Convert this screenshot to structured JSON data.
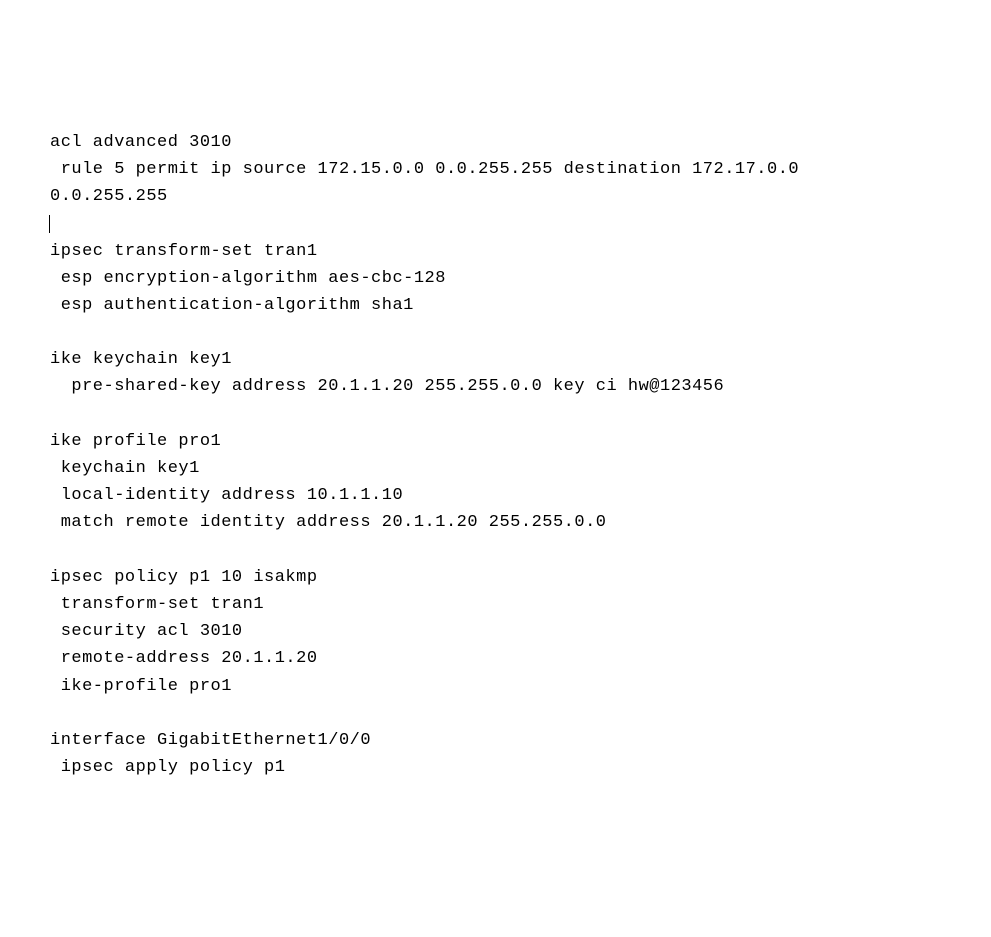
{
  "config": {
    "lines": [
      "acl advanced 3010",
      " rule 5 permit ip source 172.15.0.0 0.0.255.255 destination 172.17.0.0",
      "0.0.255.255",
      "",
      "ipsec transform-set tran1",
      " esp encryption-algorithm aes-cbc-128",
      " esp authentication-algorithm sha1",
      "",
      "ike keychain key1",
      "  pre-shared-key address 20.1.1.20 255.255.0.0 key ci hw@123456",
      "",
      "ike profile pro1",
      " keychain key1",
      " local-identity address 10.1.1.10",
      " match remote identity address 20.1.1.20 255.255.0.0",
      "",
      "ipsec policy p1 10 isakmp",
      " transform-set tran1",
      " security acl 3010",
      " remote-address 20.1.1.20",
      " ike-profile pro1",
      "",
      "interface GigabitEthernet1/0/0",
      " ipsec apply policy p1"
    ]
  }
}
